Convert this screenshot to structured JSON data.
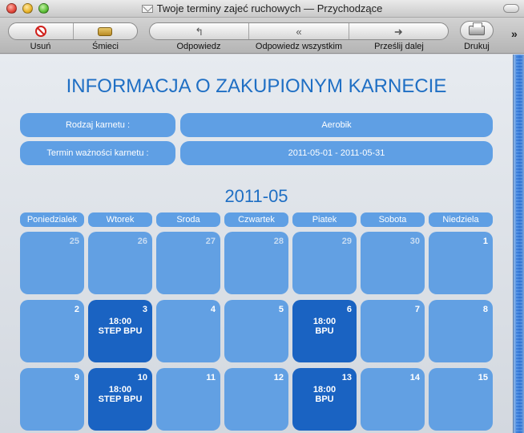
{
  "window": {
    "title": "Twoje terminy zajeć ruchowych — Przychodzące"
  },
  "toolbar": {
    "delete": "Usuń",
    "junk": "Śmieci",
    "reply": "Odpowiedz",
    "reply_all": "Odpowiedz wszystkim",
    "forward": "Prześlij dalej",
    "print": "Drukuj"
  },
  "email": {
    "heading": "INFORMACJA O ZAKUPIONYM KARNECIE",
    "ticket_type_label": "Rodzaj karnetu :",
    "ticket_type_value": "Aerobik",
    "validity_label": "Termin ważności karnetu :",
    "validity_value": "2011-05-01 - 2011-05-31",
    "month": "2011-05",
    "weekdays": [
      "Poniedzialek",
      "Wtorek",
      "Sroda",
      "Czwartek",
      "Piatek",
      "Sobota",
      "Niedziela"
    ],
    "weeks": [
      [
        {
          "day": "25",
          "faded": true
        },
        {
          "day": "26",
          "faded": true
        },
        {
          "day": "27",
          "faded": true
        },
        {
          "day": "28",
          "faded": true
        },
        {
          "day": "29",
          "faded": true
        },
        {
          "day": "30",
          "faded": true
        },
        {
          "day": "1"
        }
      ],
      [
        {
          "day": "2"
        },
        {
          "day": "3",
          "time": "18:00",
          "name": "STEP BPU"
        },
        {
          "day": "4"
        },
        {
          "day": "5"
        },
        {
          "day": "6",
          "time": "18:00",
          "name": "BPU"
        },
        {
          "day": "7"
        },
        {
          "day": "8"
        }
      ],
      [
        {
          "day": "9"
        },
        {
          "day": "10",
          "time": "18:00",
          "name": "STEP BPU"
        },
        {
          "day": "11"
        },
        {
          "day": "12"
        },
        {
          "day": "13",
          "time": "18:00",
          "name": "BPU"
        },
        {
          "day": "14"
        },
        {
          "day": "15"
        }
      ]
    ]
  }
}
